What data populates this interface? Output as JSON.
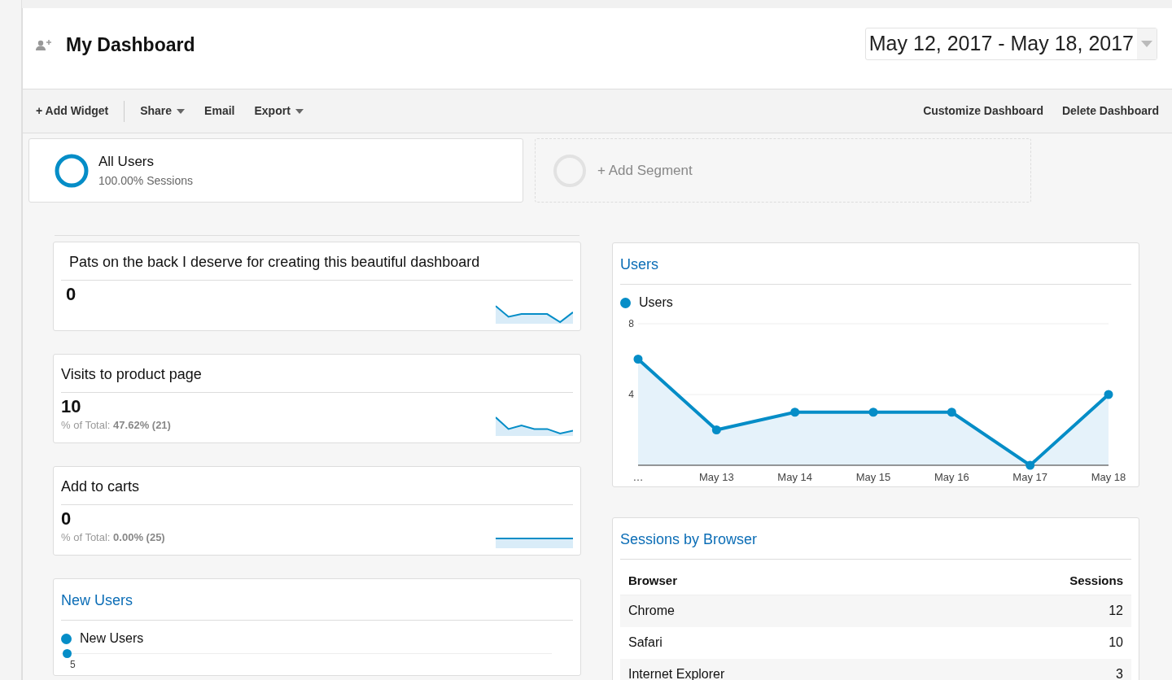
{
  "header": {
    "title": "My Dashboard",
    "date_range": "May 12, 2017 - May 18, 2017"
  },
  "toolbar": {
    "left": [
      {
        "label": "+ Add Widget",
        "kind": "plain"
      },
      {
        "label": "Share",
        "kind": "dropdown"
      },
      {
        "label": "Email",
        "kind": "plain"
      },
      {
        "label": "Export",
        "kind": "dropdown"
      }
    ],
    "right": [
      "Customize Dashboard",
      "Delete Dashboard"
    ]
  },
  "segments": [
    {
      "name": "All Users",
      "detail": "100.00% Sessions",
      "kind": "active"
    },
    {
      "name": "+ Add Segment",
      "kind": "placeholder"
    }
  ],
  "metric_widgets": [
    {
      "title": "Pats on the back I deserve for creating this beautiful dashboard",
      "value": "0"
    },
    {
      "title": "Visits to product page",
      "value": "10",
      "total_label": "% of Total:",
      "total_value": "47.62% (21)"
    },
    {
      "title": "Add to carts",
      "value": "0",
      "total_label": "% of Total:",
      "total_value": "0.00% (25)"
    }
  ],
  "new_users": {
    "title": "New Users",
    "legend": "New Users",
    "visible_tick": "5"
  },
  "users_chart": {
    "title": "Users",
    "chart_data": {
      "type": "area",
      "categories": [
        "…",
        "May 13",
        "May 14",
        "May 15",
        "May 16",
        "May 17",
        "May 18"
      ],
      "series": [
        {
          "name": "Users",
          "color": "#058dc7",
          "values": [
            6,
            2,
            3,
            3,
            3,
            0,
            4
          ]
        }
      ],
      "ylim": [
        0,
        8
      ],
      "yticks": [
        4,
        8
      ]
    }
  },
  "browser_table": {
    "title": "Sessions by Browser",
    "columns": [
      "Browser",
      "Sessions"
    ],
    "rows": [
      [
        "Chrome",
        "12"
      ],
      [
        "Safari",
        "10"
      ],
      [
        "Internet Explorer",
        "3"
      ]
    ]
  }
}
